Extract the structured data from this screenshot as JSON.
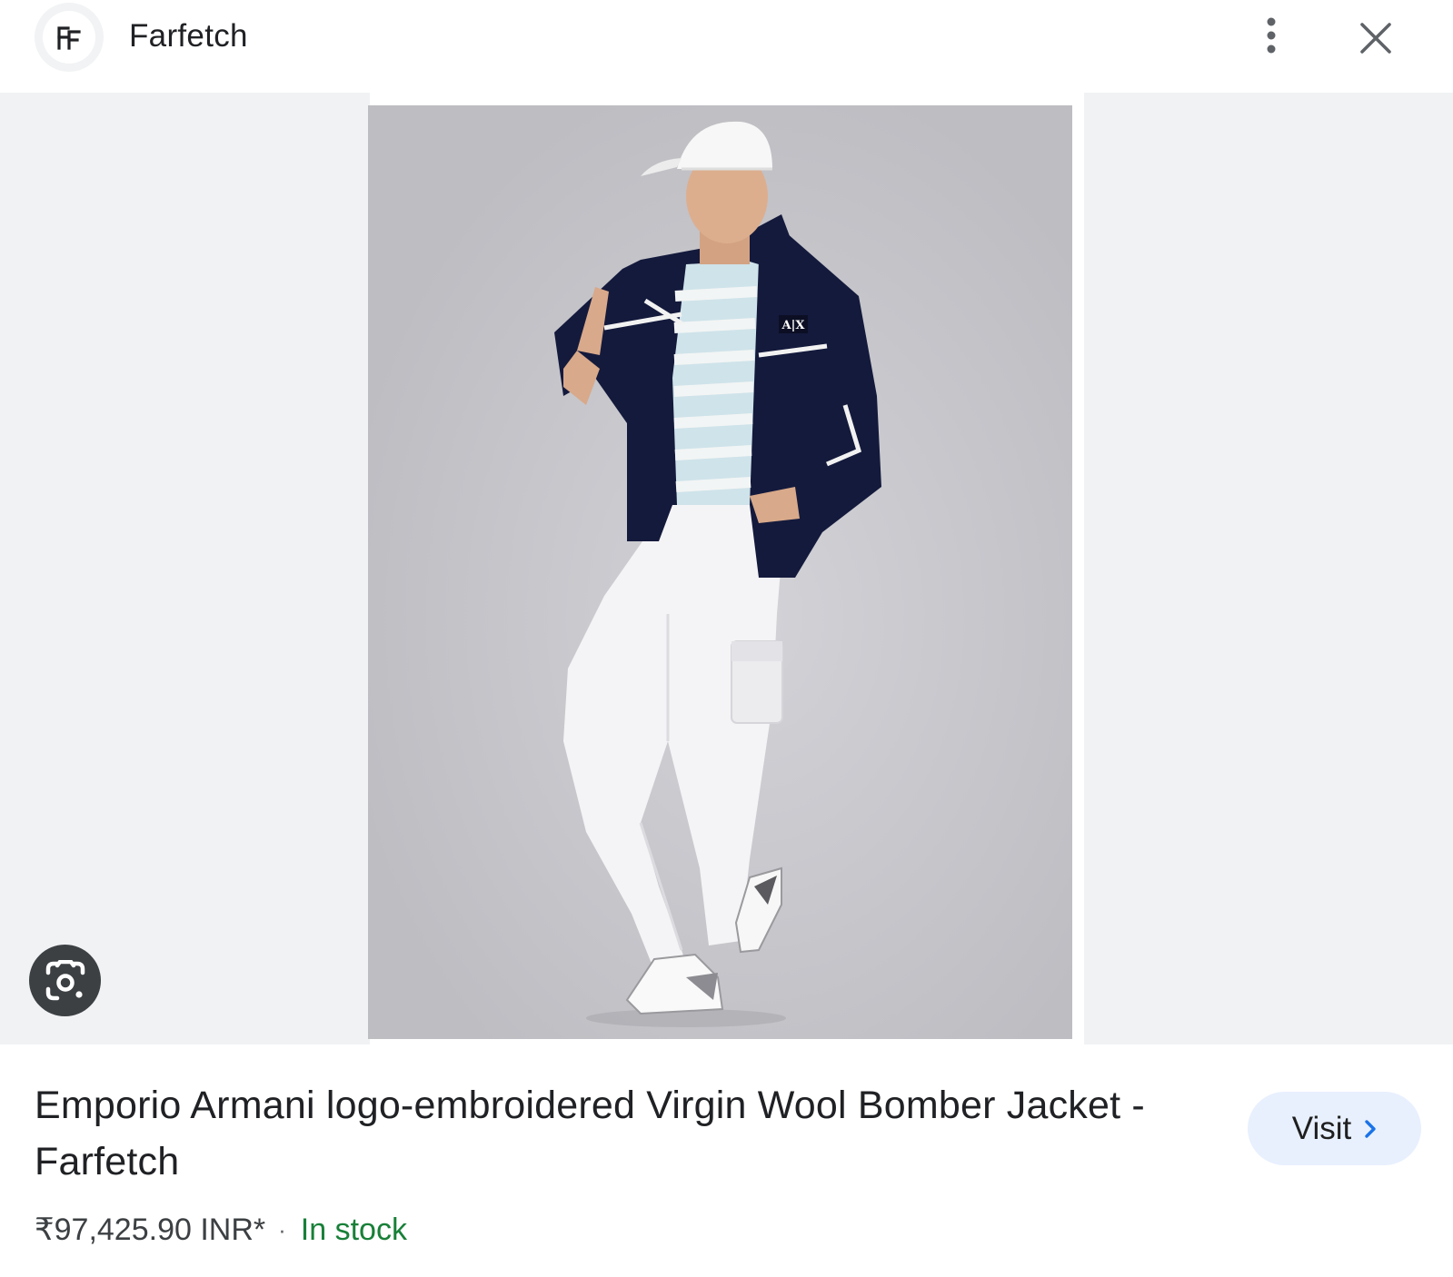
{
  "header": {
    "site_name": "Farfetch",
    "logo_icon": "farfetch-ff-logo",
    "more_icon": "more-vert-icon",
    "close_icon": "close-icon"
  },
  "image": {
    "alt": "Emporio Armani logo-embroidered Virgin Wool Bomber Jacket",
    "lens_icon": "google-lens-icon",
    "badge_text": "A|X"
  },
  "product": {
    "title": "Emporio Armani logo-embroidered Virgin Wool Bomber Jacket - Farfetch",
    "price": "₹97,425.90 INR*",
    "separator": "·",
    "availability": "In stock"
  },
  "actions": {
    "visit_label": "Visit",
    "visit_icon": "chevron-right-icon"
  },
  "colors": {
    "accent_blue": "#1a73e8",
    "visit_bg": "#e8f0fe",
    "stock_green": "#188038",
    "gallery_bg": "#f1f2f4"
  }
}
